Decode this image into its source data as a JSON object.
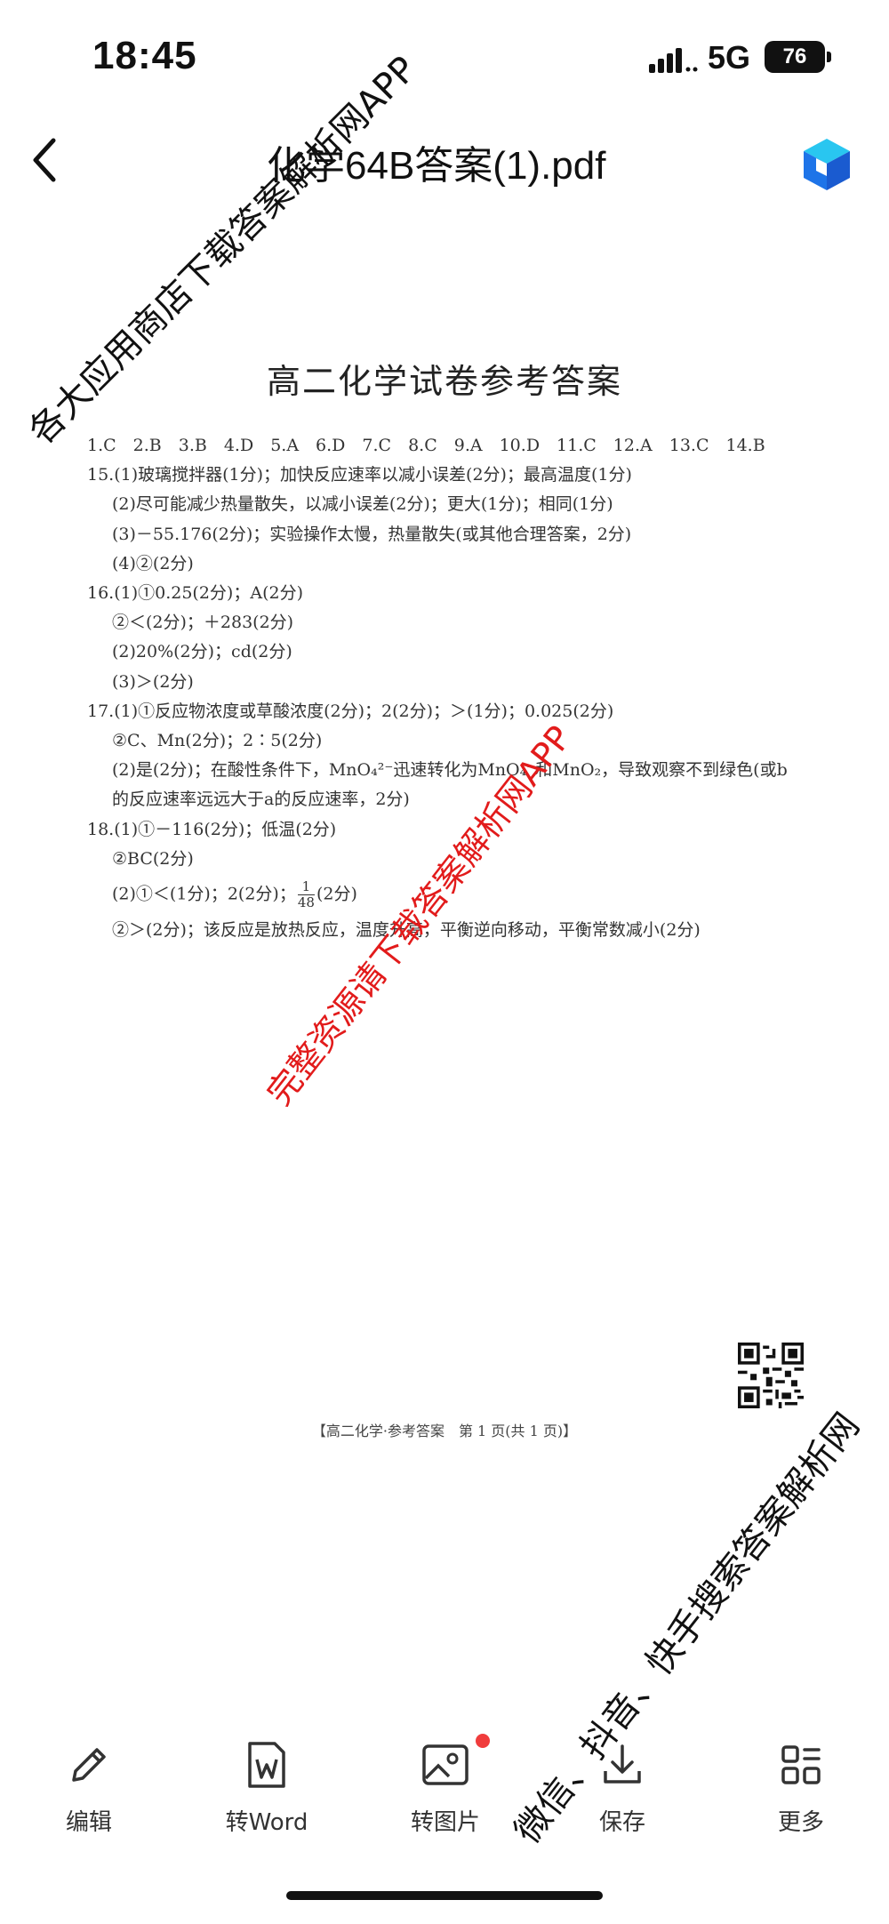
{
  "status_bar": {
    "time": "18:45",
    "network": "5G",
    "battery": "76"
  },
  "header": {
    "title": "化学64B答案(1).pdf"
  },
  "document": {
    "title": "高二化学试卷参考答案",
    "lines": [
      "1.C　2.B　3.B　4.D　5.A　6.D　7.C　8.C　9.A　10.D　11.C　12.A　13.C　14.B",
      "15.(1)玻璃搅拌器(1分)；加快反应速率以减小误差(2分)；最高温度(1分)",
      "(2)尽可能减少热量散失，以减小误差(2分)；更大(1分)；相同(1分)",
      "(3)－55.176(2分)；实验操作太慢，热量散失(或其他合理答案，2分)",
      "(4)②(2分)",
      "16.(1)①0.25(2分)；A(2分)",
      "②＜(2分)；＋283(2分)",
      "(2)20%(2分)；cd(2分)",
      "(3)＞(2分)",
      "17.(1)①反应物浓度或草酸浓度(2分)；2(2分)；＞(1分)；0.025(2分)",
      "②C、Mn(2分)；2∶5(2分)",
      "(2)是(2分)；在酸性条件下，MnO₄²⁻迅速转化为MnO₄⁻和MnO₂，导致观察不到绿色(或b",
      "的反应速率远远大于a的反应速率，2分)",
      "18.(1)①－116(2分)；低温(2分)",
      "②BC(2分)",
      "(2)①＜(1分)；2(2分)；",
      "(2分)",
      "②＞(2分)；该反应是放热反应，温度升高，平衡逆向移动，平衡常数减小(2分)"
    ],
    "fraction": {
      "numerator": "1",
      "denominator": "48"
    },
    "footer": "【高二化学·参考答案　第 1 页(共 1 页)】"
  },
  "watermarks": {
    "top_left": "各大应用商店下载答案解析网APP",
    "center": "完整资源请下载答案解析网APP",
    "bottom_right": "微信、抖音、快手搜索答案解析网"
  },
  "toolbar": {
    "edit": "编辑",
    "to_word": "转Word",
    "to_image": "转图片",
    "save": "保存",
    "more": "更多"
  }
}
